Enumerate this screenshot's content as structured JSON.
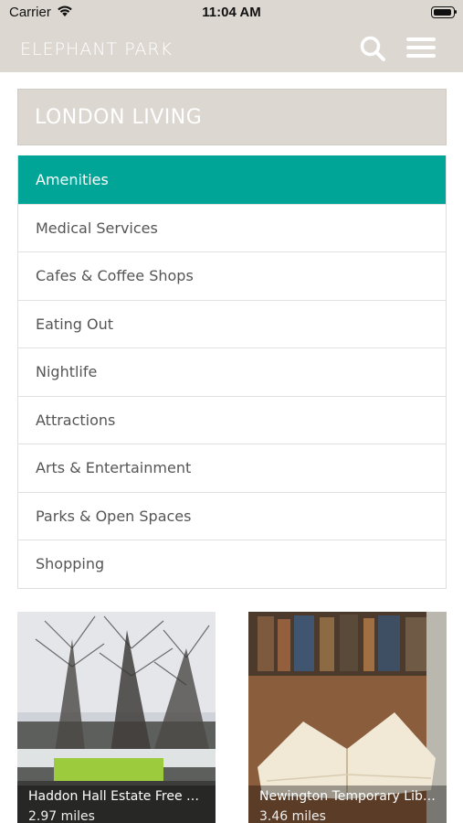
{
  "status_bar": {
    "carrier": "Carrier",
    "time": "11:04 AM"
  },
  "header": {
    "brand": "ELEPHANT PARK",
    "search_icon": "search-icon",
    "menu_icon": "hamburger-menu-icon"
  },
  "section": {
    "title": "LONDON LIVING"
  },
  "categories": [
    {
      "label": "Amenities",
      "active": true
    },
    {
      "label": "Medical Services",
      "active": false
    },
    {
      "label": "Cafes & Coffee Shops",
      "active": false
    },
    {
      "label": "Eating Out",
      "active": false
    },
    {
      "label": "Nightlife",
      "active": false
    },
    {
      "label": "Attractions",
      "active": false
    },
    {
      "label": "Arts & Entertainment",
      "active": false
    },
    {
      "label": "Parks & Open Spaces",
      "active": false
    },
    {
      "label": "Shopping",
      "active": false
    }
  ],
  "places": [
    {
      "title": "Haddon Hall Estate Free O...",
      "distance": "2.97 miles"
    },
    {
      "title": "Newington Temporary Libr...",
      "distance": "3.46 miles"
    }
  ],
  "colors": {
    "header_bg": "#dcd8d1",
    "accent": "#00a597"
  }
}
